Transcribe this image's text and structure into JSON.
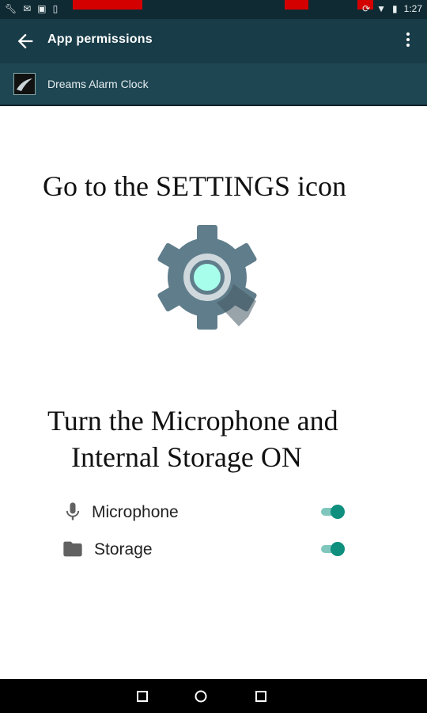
{
  "status_bar": {
    "time": "1:27"
  },
  "app_bar": {
    "title": "App permissions"
  },
  "app_header": {
    "app_name": "Dreams Alarm Clock"
  },
  "instructions": {
    "heading1": "Go to the SETTINGS icon",
    "heading2_line1": "Turn the Microphone and",
    "heading2_line2": "Internal Storage ON"
  },
  "permissions": [
    {
      "label": "Microphone",
      "icon": "microphone-icon",
      "enabled": true
    },
    {
      "label": "Storage",
      "icon": "folder-icon",
      "enabled": true
    }
  ],
  "colors": {
    "app_bar": "#183c48",
    "status_bar": "#0f2a33",
    "toggle_on": "#0f8f7e",
    "gear_body": "#607d8b",
    "gear_center": "#a7ffeb"
  }
}
